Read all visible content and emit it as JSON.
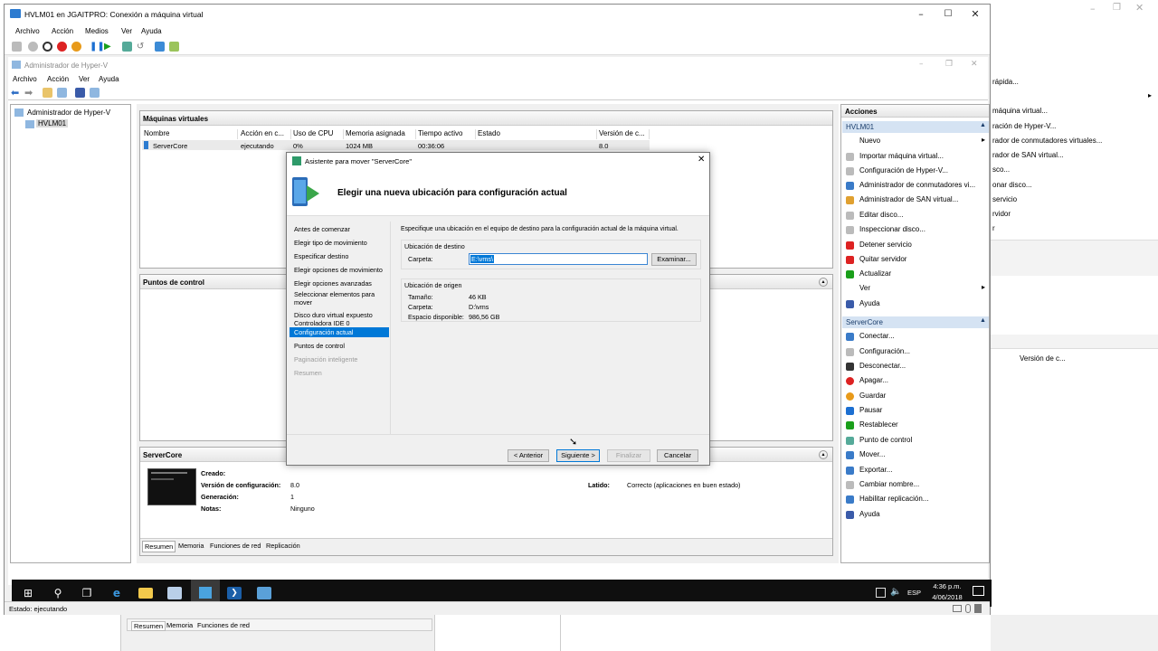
{
  "vm_window": {
    "title": "HVLM01 en JGAITPRO: Conexión a máquina virtual",
    "menu": [
      "Archivo",
      "Acción",
      "Medios",
      "Ver",
      "Ayuda"
    ],
    "status": "Estado: ejecutando"
  },
  "hyperv": {
    "title": "Administrador de Hyper-V",
    "menu": [
      "Archivo",
      "Acción",
      "Ver",
      "Ayuda"
    ],
    "tree_root": "Administrador de Hyper-V",
    "tree_child": "HVLM01",
    "vms_header": "Máquinas virtuales",
    "columns": [
      "Nombre",
      "Acción en c...",
      "Uso de CPU",
      "Memoria asignada",
      "Tiempo activo",
      "Estado",
      "Versión de c..."
    ],
    "vm_row": {
      "name": "ServerCore",
      "action": "ejecutando",
      "cpu": "0%",
      "memory": "1024 MB",
      "uptime": "00:36:06",
      "status": "",
      "version": "8.0"
    },
    "checkpoints_header": "Puntos de control",
    "details_header": "ServerCore",
    "details": {
      "created_label": "Creado:",
      "config_label": "Versión de configuración:",
      "config_value": "8.0",
      "gen_label": "Generación:",
      "gen_value": "1",
      "notes_label": "Notas:",
      "notes_value": "Ninguno",
      "heartbeat_label": "Latido:",
      "heartbeat_value": "Correcto (aplicaciones en buen estado)"
    },
    "detail_tabs": [
      "Resumen",
      "Memoria",
      "Funciones de red",
      "Replicación"
    ]
  },
  "actions": {
    "title": "Acciones",
    "host_section": "HVLM01",
    "host_items": [
      "Nuevo",
      "Importar máquina virtual...",
      "Configuración de Hyper-V...",
      "Administrador de conmutadores vi...",
      "Administrador de SAN virtual...",
      "Editar disco...",
      "Inspeccionar disco...",
      "Detener servicio",
      "Quitar servidor",
      "Actualizar",
      "Ver",
      "Ayuda"
    ],
    "vm_section": "ServerCore",
    "vm_items": [
      "Conectar...",
      "Configuración...",
      "Desconectar...",
      "Apagar...",
      "Guardar",
      "Pausar",
      "Restablecer",
      "Punto de control",
      "Mover...",
      "Exportar...",
      "Cambiar nombre...",
      "Habilitar replicación...",
      "Ayuda"
    ]
  },
  "wizard": {
    "title": "Asistente para mover \"ServerCore\"",
    "heading": "Elegir una nueva ubicación para configuración actual",
    "steps": [
      "Antes de comenzar",
      "Elegir tipo de movimiento",
      "Especificar destino",
      "Elegir opciones de movimiento",
      "Elegir opciones avanzadas",
      "Seleccionar elementos para mover",
      "Disco duro virtual expuesto Controladora IDE 0",
      "Configuración actual",
      "Puntos de control",
      "Paginación inteligente",
      "Resumen"
    ],
    "instruction": "Especifique una ubicación en el equipo de destino para la configuración actual de la máquina virtual.",
    "dest_group": "Ubicación de destino",
    "folder_label": "Carpeta:",
    "folder_value": "E:\\vms\\",
    "browse": "Examinar...",
    "source_group": "Ubicación de origen",
    "size_label": "Tamaño:",
    "size_value": "46 KB",
    "src_folder_label": "Carpeta:",
    "src_folder_value": "D:\\vms",
    "space_label": "Espacio disponible:",
    "space_value": "986,56 GB",
    "buttons": {
      "back": "< Anterior",
      "next": "Siguiente >",
      "finish": "Finalizar",
      "cancel": "Cancelar"
    }
  },
  "taskbar": {
    "lang": "ESP",
    "time": "4:36 p.m.",
    "date": "4/06/2018"
  },
  "host_bg": {
    "lines": [
      "rápida...",
      "máquina virtual...",
      "ración de Hyper-V...",
      "rador de conmutadores virtuales...",
      "rador de SAN virtual...",
      "sco...",
      "onar disco...",
      "servicio",
      "rvidor",
      "r",
      "Versión de c..."
    ],
    "tabs": [
      "Resumen",
      "Memoria",
      "Funciones de red"
    ]
  },
  "colors": {
    "selection": "#0078d7",
    "accent": "#1a3d6b"
  }
}
